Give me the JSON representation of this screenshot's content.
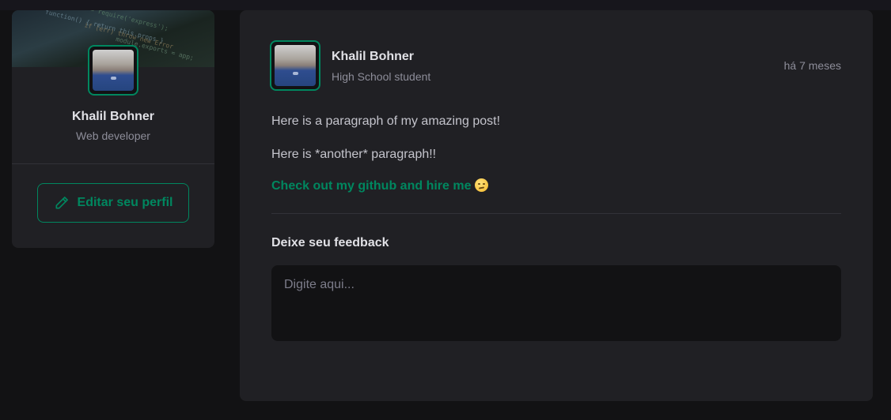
{
  "sidebar": {
    "name": "Khalil Bohner",
    "role": "Web developer",
    "edit_button_label": "Editar seu perfil",
    "edit_icon": "pencil-icon"
  },
  "post": {
    "author": {
      "name": "Khalil Bohner",
      "role": "High School student"
    },
    "published": "há 7 meses",
    "paragraphs": [
      "Here is a paragraph of my amazing post!",
      "Here is *another* paragraph!!"
    ],
    "link_text": "Check out my github and hire me",
    "link_emoji": "smirking-face-icon",
    "feedback": {
      "title": "Deixe seu feedback",
      "placeholder": "Digite aqui..."
    }
  },
  "colors": {
    "background": "#121214",
    "card": "#202024",
    "accent": "#00875f",
    "text": "#e1e1e6",
    "muted": "#8d8d99"
  }
}
